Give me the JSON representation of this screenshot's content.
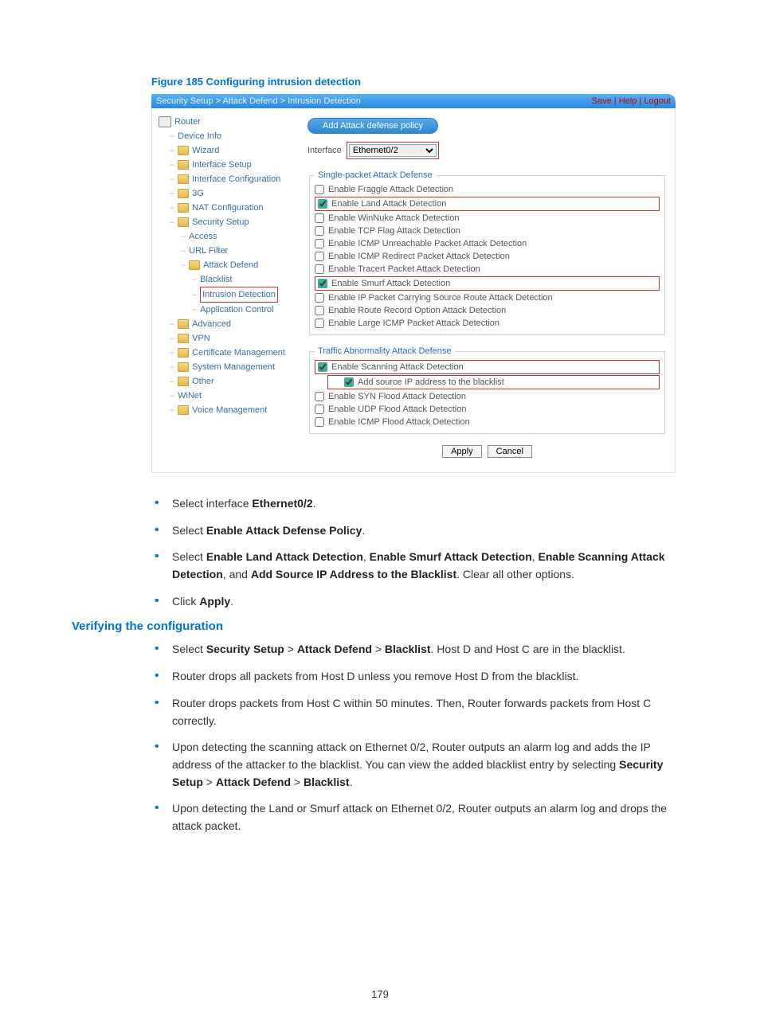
{
  "figure_title": "Figure 185 Configuring intrusion detection",
  "topbar": {
    "breadcrumb": "Security Setup > Attack Defend > Intrusion Detection",
    "links": {
      "save": "Save",
      "help": "Help",
      "logout": "Logout"
    }
  },
  "nav": {
    "root": "Router",
    "items": [
      "Device Info",
      "Wizard",
      "Interface Setup",
      "Interface Configuration",
      "3G",
      "NAT Configuration",
      "Security Setup"
    ],
    "security_children": [
      "Access",
      "URL Filter",
      "Attack Defend"
    ],
    "attack_children": [
      "Blacklist",
      "Intrusion Detection",
      "Application Control"
    ],
    "after": [
      "Advanced",
      "VPN",
      "Certificate Management",
      "System Management",
      "Other",
      "WiNet",
      "Voice Management"
    ]
  },
  "content": {
    "launch_label": "Add Attack defense policy",
    "iface_label": "Interface",
    "iface_value": "Ethernet0/2",
    "group1_title": "Single-packet Attack Defense",
    "group1_opts": [
      {
        "label": "Enable Fraggle Attack Detection",
        "checked": false,
        "boxed": false
      },
      {
        "label": "Enable Land Attack Detection",
        "checked": true,
        "boxed": true
      },
      {
        "label": "Enable WinNuke Attack Detection",
        "checked": false,
        "boxed": false
      },
      {
        "label": "Enable TCP Flag Attack Detection",
        "checked": false,
        "boxed": false
      },
      {
        "label": "Enable ICMP Unreachable Packet Attack Detection",
        "checked": false,
        "boxed": false
      },
      {
        "label": "Enable ICMP Redirect Packet Attack Detection",
        "checked": false,
        "boxed": false
      },
      {
        "label": "Enable Tracert Packet Attack Detection",
        "checked": false,
        "boxed": false
      },
      {
        "label": "Enable Smurf Attack Detection",
        "checked": true,
        "boxed": true
      },
      {
        "label": "Enable IP Packet Carrying Source Route Attack Detection",
        "checked": false,
        "boxed": false
      },
      {
        "label": "Enable Route Record Option Attack Detection",
        "checked": false,
        "boxed": false
      },
      {
        "label": "Enable Large ICMP Packet Attack Detection",
        "checked": false,
        "boxed": false
      }
    ],
    "group2_title": "Traffic Abnormality Attack Defense",
    "group2_opts": [
      {
        "label": "Enable Scanning Attack Detection",
        "checked": true,
        "boxed": true,
        "sub": false
      },
      {
        "label": "Add source IP address to the blacklist",
        "checked": true,
        "boxed": true,
        "sub": true
      },
      {
        "label": "Enable SYN Flood Attack Detection",
        "checked": false,
        "boxed": false,
        "sub": false
      },
      {
        "label": "Enable UDP Flood Attack Detection",
        "checked": false,
        "boxed": false,
        "sub": false
      },
      {
        "label": "Enable ICMP Flood Attack Detection",
        "checked": false,
        "boxed": false,
        "sub": false
      }
    ],
    "apply": "Apply",
    "cancel": "Cancel"
  },
  "instructions1": {
    "i1a": "Select interface ",
    "i1b": "Ethernet0/2",
    "i1c": ".",
    "i2a": "Select ",
    "i2b": "Enable Attack Defense Policy",
    "i2c": ".",
    "i3a": "Select ",
    "i3b": "Enable Land Attack Detection",
    "i3c": ", ",
    "i3d": "Enable Smurf Attack Detection",
    "i3e": ", ",
    "i3f": "Enable Scanning Attack Detection",
    "i3g": ", and ",
    "i3h": "Add Source IP Address to the Blacklist",
    "i3i": ". Clear all other options.",
    "i4a": "Click ",
    "i4b": "Apply",
    "i4c": "."
  },
  "section2_title": "Verifying the configuration",
  "instructions2": {
    "v1a": "Select ",
    "v1b": "Security Setup",
    "v1c": " > ",
    "v1d": "Attack Defend",
    "v1e": " > ",
    "v1f": "Blacklist",
    "v1g": ". Host D and Host C are in the blacklist.",
    "v2": "Router drops all packets from Host D unless you remove Host D from the blacklist.",
    "v3": "Router drops packets from Host C within 50 minutes. Then, Router forwards packets from Host C correctly.",
    "v4a": "Upon detecting the scanning attack on Ethernet 0/2, Router outputs an alarm log and adds the IP address of the attacker to the blacklist. You can view the added blacklist entry by selecting ",
    "v4b": "Security Setup",
    "v4c": " > ",
    "v4d": "Attack Defend",
    "v4e": " > ",
    "v4f": "Blacklist",
    "v4g": ".",
    "v5": "Upon detecting the Land or Smurf attack on Ethernet 0/2, Router outputs an alarm log and drops the attack packet."
  },
  "page_number": "179"
}
